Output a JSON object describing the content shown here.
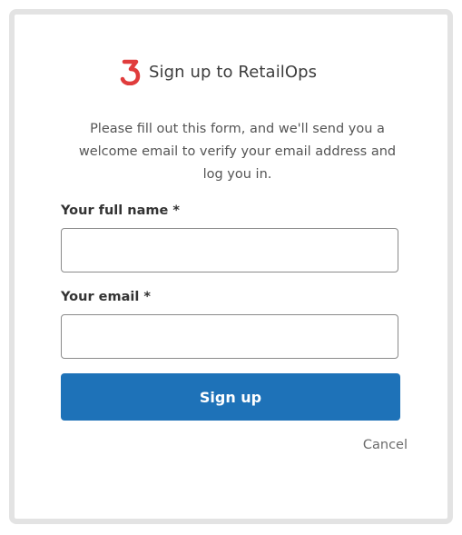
{
  "header": {
    "title": "Sign up to RetailOps",
    "logo_icon": "retailops-logo-icon",
    "logo_color": "#e03c3c"
  },
  "intro": "Please fill out this form, and we'll send you a welcome email to verify your email address and log you in.",
  "form": {
    "full_name_label": "Your full name *",
    "full_name_value": "",
    "email_label": "Your email *",
    "email_value": ""
  },
  "actions": {
    "signup_label": "Sign up",
    "cancel_label": "Cancel"
  },
  "colors": {
    "primary": "#1e72b8",
    "frame_border": "#e3e3e3"
  }
}
